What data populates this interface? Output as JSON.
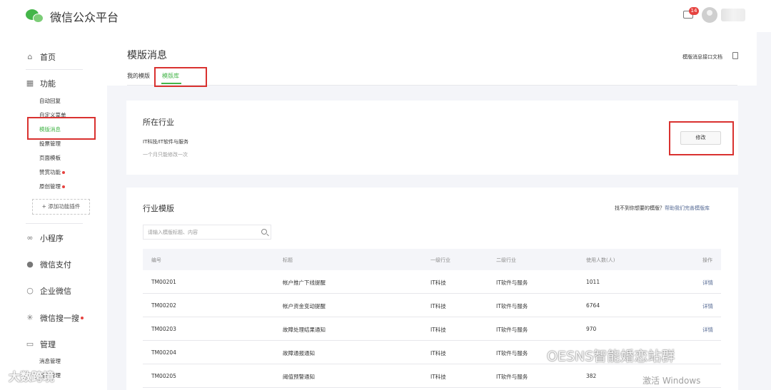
{
  "app": {
    "title": "微信公众平台",
    "unread_count": "14"
  },
  "sidebar": {
    "home": "首页",
    "features": "功能",
    "feature_items": [
      {
        "label": "自动回复",
        "dot": false
      },
      {
        "label": "自定义菜单",
        "dot": false
      },
      {
        "label": "模版消息",
        "dot": false
      },
      {
        "label": "投票管理",
        "dot": false
      },
      {
        "label": "页面模板",
        "dot": false
      },
      {
        "label": "赞赏功能",
        "dot": true
      },
      {
        "label": "原创管理",
        "dot": true
      }
    ],
    "add_plugin": "添加功能插件",
    "miniprogram": "小程序",
    "wechat_pay": "微信支付",
    "work_wechat": "企业微信",
    "search": "微信搜一搜",
    "manage": "管理",
    "manage_items": [
      "消息管理",
      "用户管理"
    ]
  },
  "page": {
    "title": "模版消息",
    "doc_link": "模版消息接口文档",
    "tabs": [
      "我的模版",
      "模版库"
    ]
  },
  "industry": {
    "title": "所在行业",
    "value": "IT科技/IT软件与服务",
    "note": "一个月只能修改一次",
    "modify_button": "修改"
  },
  "templates": {
    "title": "行业模版",
    "help_prefix": "找不到你想要的模版？",
    "help_link": "帮助我们完善模版库",
    "search_placeholder": "请输入模版标题、内容",
    "columns": [
      "编号",
      "标题",
      "一级行业",
      "二级行业",
      "使用人数(人)",
      "操作"
    ],
    "rows": [
      {
        "id": "TM00201",
        "title": "帐户推广下线提醒",
        "l1": "IT科技",
        "l2": "IT软件与服务",
        "count": "1011",
        "op": "详情"
      },
      {
        "id": "TM00202",
        "title": "帐户资金变动提醒",
        "l1": "IT科技",
        "l2": "IT软件与服务",
        "count": "6764",
        "op": "详情"
      },
      {
        "id": "TM00203",
        "title": "故障处理结果通知",
        "l1": "IT科技",
        "l2": "IT软件与服务",
        "count": "970",
        "op": "详情"
      },
      {
        "id": "TM00204",
        "title": "故障通报通知",
        "l1": "IT科技",
        "l2": "IT软件与服务",
        "count": "",
        "op": ""
      },
      {
        "id": "TM00205",
        "title": "阈值预警通知",
        "l1": "IT科技",
        "l2": "IT软件与服务",
        "count": "382",
        "op": ""
      }
    ]
  },
  "watermarks": {
    "left": "大数跨境",
    "right": "OESNS智能婚恋站群",
    "windows": "激活 Windows"
  }
}
